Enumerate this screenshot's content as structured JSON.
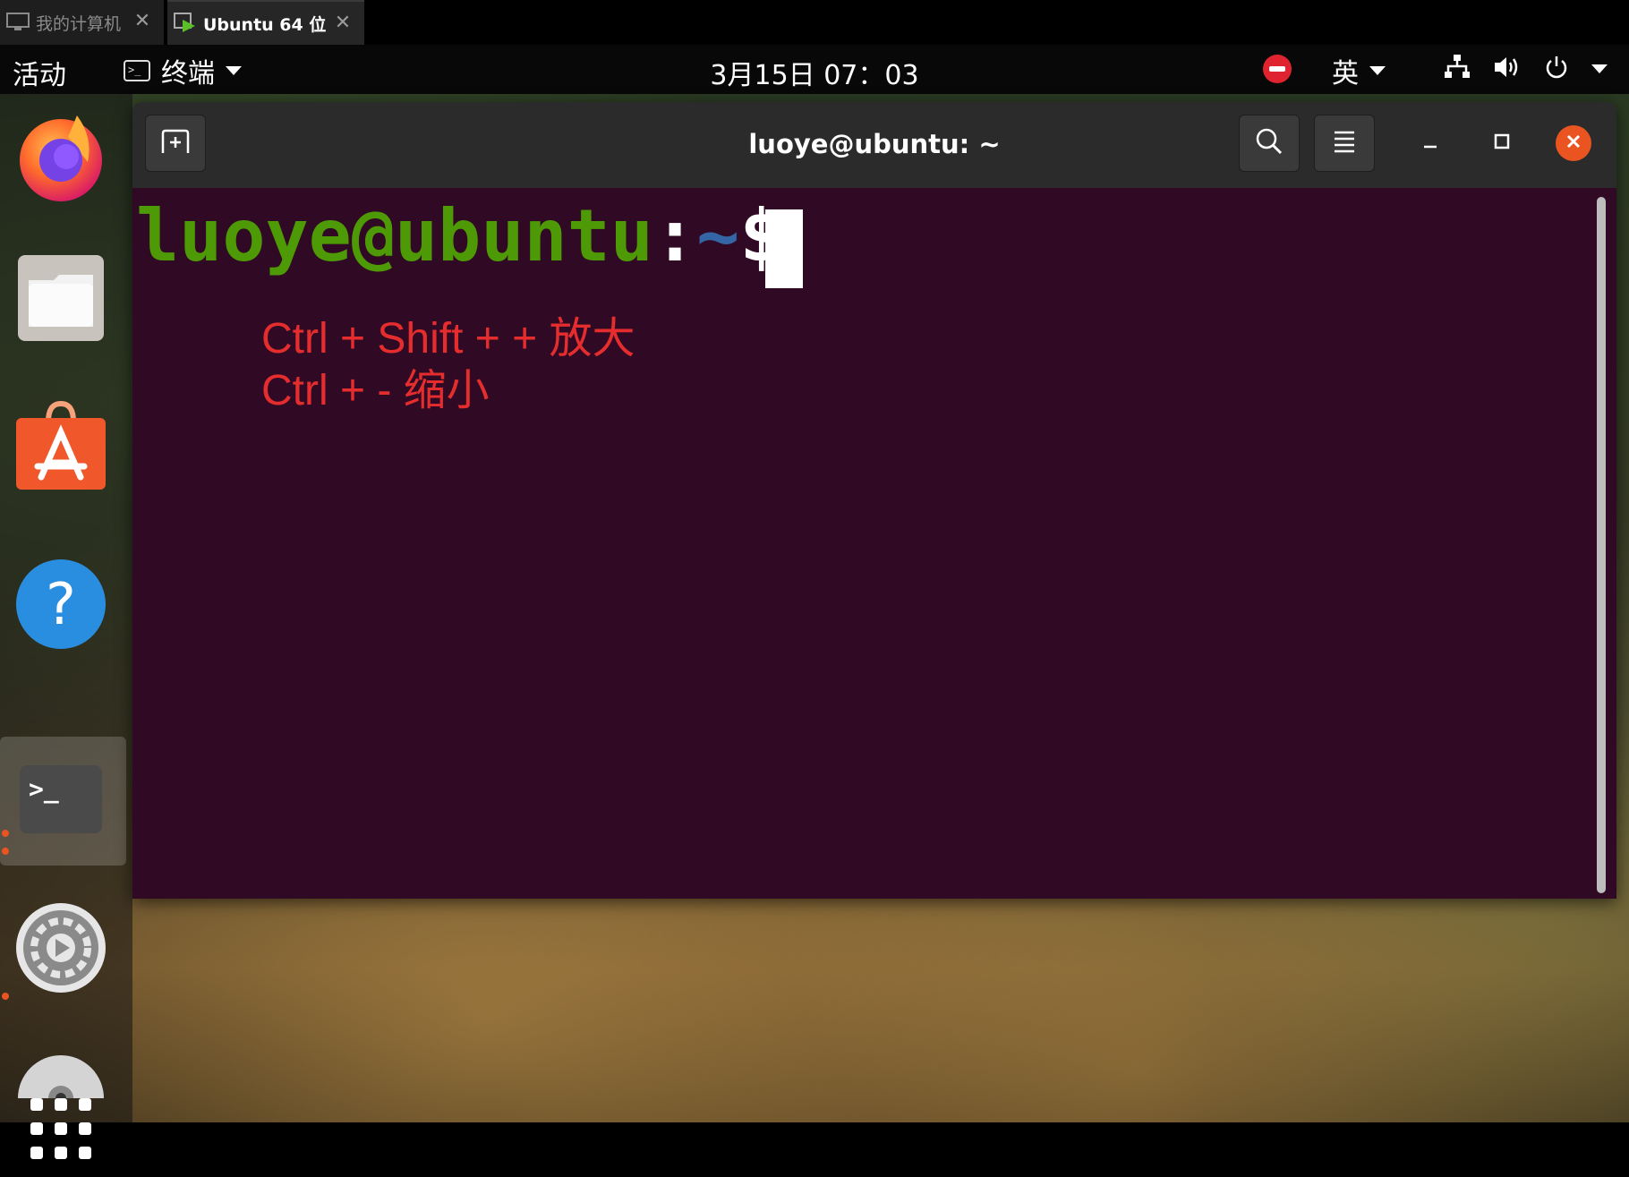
{
  "vm_tabs": [
    {
      "label": "我的计算机",
      "icon": "monitor-icon",
      "active": false
    },
    {
      "label": "Ubuntu 64 位",
      "icon": "vm-play-icon",
      "active": true
    }
  ],
  "topbar": {
    "activities": "活动",
    "app_menu_label": "终端",
    "clock": "3月15日  07：03",
    "input_method": "英"
  },
  "dock": {
    "items": [
      "firefox-icon",
      "files-icon",
      "app-store-icon",
      "help-icon",
      "terminal-icon",
      "settings-icon",
      "disc-icon",
      "app-grid-icon"
    ]
  },
  "terminal": {
    "title": "luoye@ubuntu: ~",
    "prompt_user": "luoye@ubuntu",
    "prompt_colon": ":",
    "prompt_path": "~",
    "prompt_dollar": "$ ",
    "hint_lines": [
      "Ctrl + Shift + +  放大",
      "Ctrl + -  缩小"
    ]
  },
  "colors": {
    "terminal_bg": "#300a24",
    "prompt_user": "#4e9a06",
    "prompt_path": "#3465a4",
    "hint_text": "#e62d2d",
    "accent": "#e95420"
  }
}
